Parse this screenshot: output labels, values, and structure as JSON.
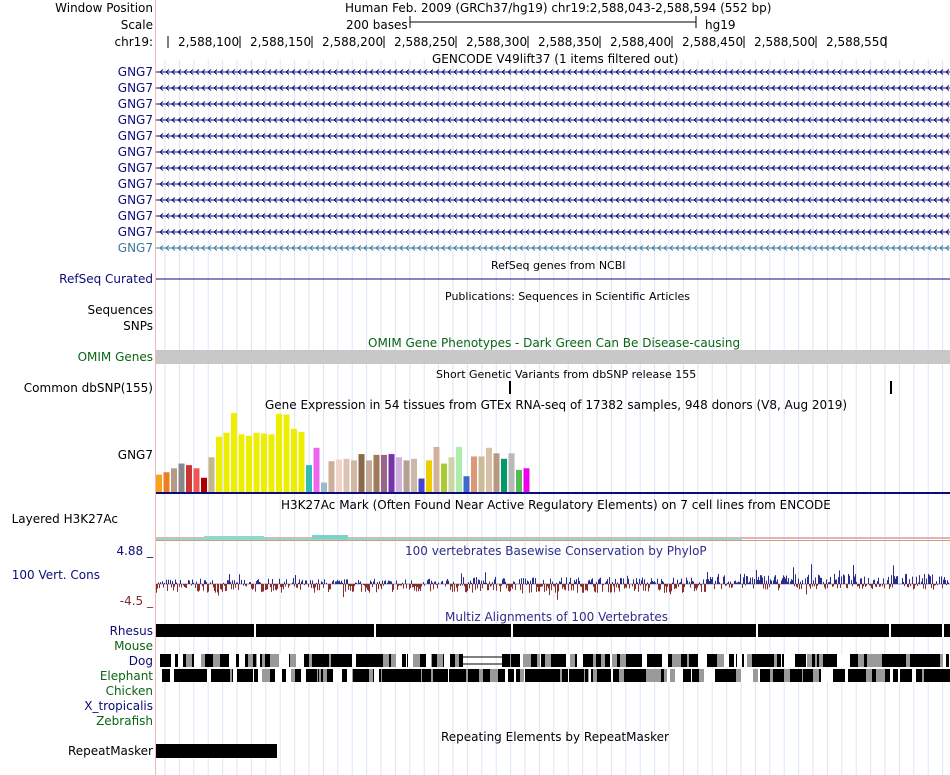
{
  "header": {
    "window_position_label": "Window Position",
    "window_position_value": "Human Feb. 2009 (GRCh37/hg19)   chr19:2,588,043-2,588,594 (552 bp)",
    "scale_label": "Scale",
    "scale_text": "200 bases",
    "assembly": "hg19",
    "chrom_label": "chr19:",
    "ticks": [
      "2,588,100",
      "2,588,150",
      "2,588,200",
      "2,588,250",
      "2,588,300",
      "2,588,350",
      "2,588,400",
      "2,588,450",
      "2,588,500",
      "2,588,550"
    ]
  },
  "gencode": {
    "title": "GENCODE V49lift37 (1 items filtered out)",
    "genes": [
      "GNG7",
      "GNG7",
      "GNG7",
      "GNG7",
      "GNG7",
      "GNG7",
      "GNG7",
      "GNG7",
      "GNG7",
      "GNG7",
      "GNG7",
      "GNG7"
    ]
  },
  "refseq": {
    "label": "RefSeq Curated",
    "title": "RefSeq genes from NCBI"
  },
  "pubs": {
    "title": "Publications: Sequences in Scientific Articles",
    "label1": "Sequences",
    "label2": "SNPs"
  },
  "omim": {
    "label": "OMIM Genes",
    "title": "OMIM Gene Phenotypes - Dark Green Can Be Disease-causing"
  },
  "dbsnp": {
    "label": "Common dbSNP(155)",
    "title": "Short Genetic Variants from dbSNP release 155"
  },
  "gtex": {
    "title": "Gene Expression in 54 tissues from GTEx RNA-seq of 17382 samples, 948 donors (V8, Aug 2019)",
    "gene": "GNG7",
    "bars": [
      {
        "c": "#f7a31c",
        "v": 0.22
      },
      {
        "c": "#ee7d1f",
        "v": 0.25
      },
      {
        "c": "#b59a87",
        "v": 0.3
      },
      {
        "c": "#888888",
        "v": 0.36
      },
      {
        "c": "#cc3333",
        "v": 0.34
      },
      {
        "c": "#ee5555",
        "v": 0.3
      },
      {
        "c": "#aa0000",
        "v": 0.18
      },
      {
        "c": "#c4b88a",
        "v": 0.44
      },
      {
        "c": "#eeee00",
        "v": 0.7
      },
      {
        "c": "#eeee00",
        "v": 0.75
      },
      {
        "c": "#eeee00",
        "v": 1.0
      },
      {
        "c": "#eeee00",
        "v": 0.73
      },
      {
        "c": "#eeee00",
        "v": 0.71
      },
      {
        "c": "#eeee00",
        "v": 0.75
      },
      {
        "c": "#eeee00",
        "v": 0.74
      },
      {
        "c": "#eeee00",
        "v": 0.73
      },
      {
        "c": "#eeee00",
        "v": 0.99
      },
      {
        "c": "#eeee00",
        "v": 0.98
      },
      {
        "c": "#eeee00",
        "v": 0.8
      },
      {
        "c": "#eeee00",
        "v": 0.76
      },
      {
        "c": "#33bbbb",
        "v": 0.34
      },
      {
        "c": "#ee66ee",
        "v": 0.56
      },
      {
        "c": "#99bbcc",
        "v": 0.12
      },
      {
        "c": "#cfae9a",
        "v": 0.39
      },
      {
        "c": "#f0d2cc",
        "v": 0.41
      },
      {
        "c": "#dcc4b4",
        "v": 0.42
      },
      {
        "c": "#cfb8a4",
        "v": 0.4
      },
      {
        "c": "#8b6a4c",
        "v": 0.48
      },
      {
        "c": "#c4aa98",
        "v": 0.4
      },
      {
        "c": "#a0785a",
        "v": 0.47
      },
      {
        "c": "#996688",
        "v": 0.47
      },
      {
        "c": "#7733aa",
        "v": 0.48
      },
      {
        "c": "#d4b0e0",
        "v": 0.44
      },
      {
        "c": "#b4a090",
        "v": 0.4
      },
      {
        "c": "#ccb8a8",
        "v": 0.42
      },
      {
        "c": "#4444cc",
        "v": 0.17
      },
      {
        "c": "#eecc00",
        "v": 0.4
      },
      {
        "c": "#d2b09c",
        "v": 0.57
      },
      {
        "c": "#aacc33",
        "v": 0.36
      },
      {
        "c": "#ccd4aa",
        "v": 0.44
      },
      {
        "c": "#aaeeaa",
        "v": 0.57
      },
      {
        "c": "#4466cc",
        "v": 0.2
      },
      {
        "c": "#dd9977",
        "v": 0.45
      },
      {
        "c": "#ccbb99",
        "v": 0.45
      },
      {
        "c": "#d8c0a8",
        "v": 0.56
      },
      {
        "c": "#b89880",
        "v": 0.49
      },
      {
        "c": "#00996a",
        "v": 0.42
      },
      {
        "c": "#b8b8b8",
        "v": 0.49
      },
      {
        "c": "#55bb55",
        "v": 0.28
      },
      {
        "c": "#ee00ee",
        "v": 0.3
      }
    ]
  },
  "h3k27ac": {
    "label": "Layered H3K27Ac",
    "title": "H3K27Ac Mark (Often Found Near Active Regulatory Elements) on 7 cell lines from ENCODE"
  },
  "phylop": {
    "label": "100 Vert. Cons",
    "title": "100 vertebrates Basewise Conservation by PhyloP",
    "max_label": "4.88 _",
    "min_label": "-4.5 _"
  },
  "multiz": {
    "title": "Multiz Alignments of 100 Vertebrates",
    "species": [
      "Rhesus",
      "Mouse",
      "Dog",
      "Elephant",
      "Chicken",
      "X_tropicalis",
      "Zebrafish"
    ]
  },
  "repeatmasker": {
    "label": "RepeatMasker",
    "title": "Repeating Elements by RepeatMasker"
  },
  "colors": {
    "gene": "#0c0c78",
    "gene_selected": "#3c78a0",
    "omim_gray": "#c8c8c8",
    "phylop_pos": "#2c2c8c",
    "phylop_neg": "#8c2c2c",
    "grid": "#cfe0f4"
  }
}
